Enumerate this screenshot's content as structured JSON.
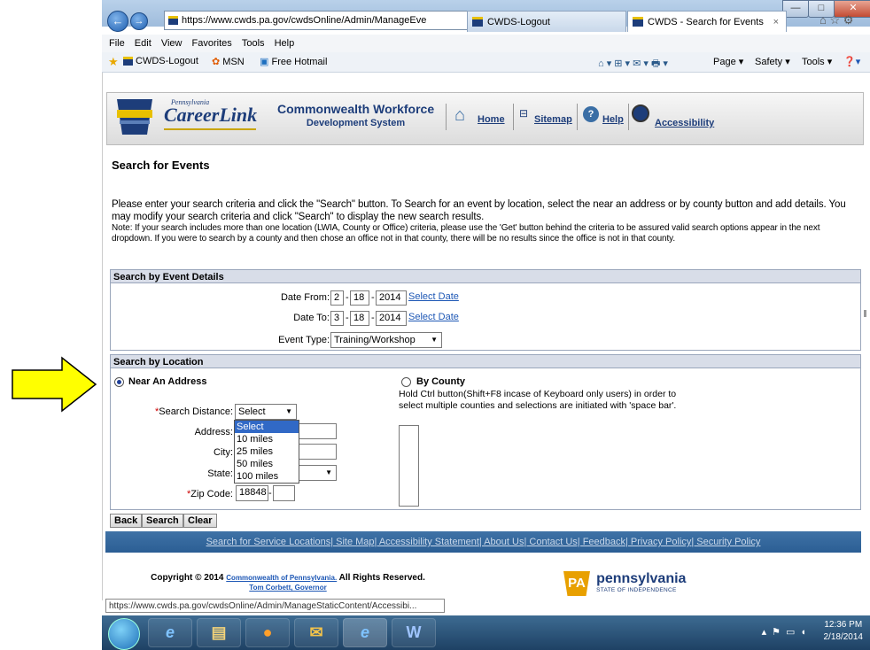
{
  "browser": {
    "url": "https://www.cwds.pa.gov/cwdsOnline/Admin/ManageEve",
    "tabs": [
      {
        "label": "CWDS-Logout"
      },
      {
        "label": "CWDS - Search for Events",
        "close": "×"
      }
    ],
    "menu": [
      "File",
      "Edit",
      "View",
      "Favorites",
      "Tools",
      "Help"
    ],
    "favorites": [
      "CWDS-Logout",
      "MSN",
      "Free Hotmail"
    ],
    "commands": [
      "Page ▾",
      "Safety ▾",
      "Tools ▾"
    ]
  },
  "header": {
    "logo_small": "Pennsylvania",
    "logo": "CareerLink",
    "system_title": "Commonwealth Workforce",
    "system_subtitle": "Development System",
    "nav": [
      "Home",
      "Sitemap",
      "Help",
      "Accessibility"
    ]
  },
  "page": {
    "title": "Search for Events",
    "intro_1": "Please enter your search criteria and click the \"Search\" button. To Search for an event by location, select the near an address or by county button and add details. You may modify your search criteria and click \"Search\" to display the new search results.",
    "intro_2": "Note: If your search includes more than one location (LWIA, County or Office) criteria, please use the 'Get' button behind the criteria to be assured valid search options appear in the next dropdown. If you were to search by a county and then chose an office not in that county, there will be no results since the office is not in that county."
  },
  "event_details": {
    "heading": "Search by Event Details",
    "date_from_label": "Date From:",
    "date_from": {
      "month": "2",
      "day": "18",
      "year": "2014"
    },
    "date_to_label": "Date To:",
    "date_to": {
      "month": "3",
      "day": "18",
      "year": "2014"
    },
    "select_date": "Select Date",
    "event_type_label": "Event Type:",
    "event_type": "Training/Workshop"
  },
  "location": {
    "heading": "Search by Location",
    "near_address": "Near An Address",
    "by_county": "By County",
    "county_note": "Hold Ctrl button(Shift+F8 incase of Keyboard only users) in order to select multiple counties and selections are initiated with 'space bar'.",
    "distance_label": "Search Distance:",
    "distance_value": "Select",
    "distance_options": [
      "Select",
      "10 miles",
      "25 miles",
      "50 miles",
      "100 miles"
    ],
    "address_label": "Address:",
    "city_label": "City:",
    "state_label": "State:",
    "zip_label": "Zip Code:",
    "zip_value": "18848",
    "required_mark": "*"
  },
  "buttons": {
    "back": "Back",
    "search": "Search",
    "clear": "Clear"
  },
  "footer": {
    "links": "Search for Service Locations| Site Map| Accessibility Statement| About Us| Contact Us| Feedback| Privacy Policy| Security Policy",
    "copyright_prefix": "Copyright © 2014",
    "copyright_link": "Commonwealth of Pennsylvania.",
    "copyright_suffix": "All Rights Reserved.",
    "governor": "Tom Corbett, Governor",
    "pa_badge": "PA",
    "pa_word": "pennsylvania",
    "pa_tagline": "STATE OF INDEPENDENCE"
  },
  "status_url": "https://www.cwds.pa.gov/cwdsOnline/Admin/ManageStaticContent/Accessibi...",
  "taskbar": {
    "time": "12:36 PM",
    "date": "2/18/2014"
  },
  "colors": {
    "accent": "#1d3d7a",
    "arrow": "#ffff00",
    "footer": "#2b5e94"
  }
}
